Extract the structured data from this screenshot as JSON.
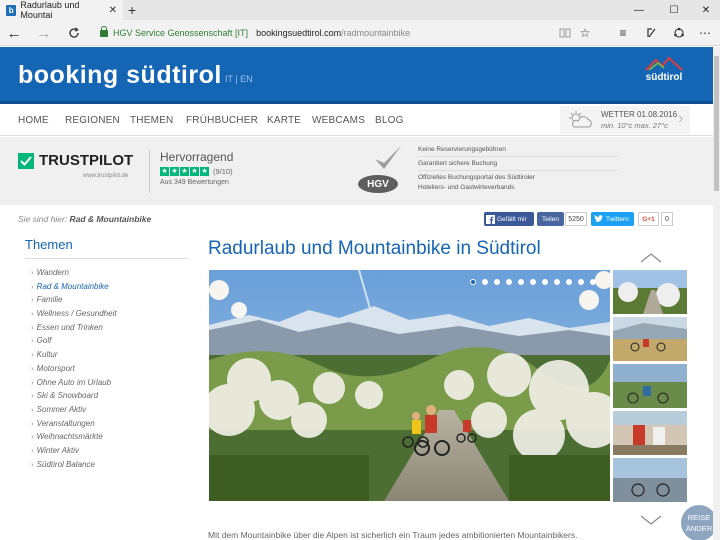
{
  "browser": {
    "tab_title": "Radurlaub und Mountai",
    "tab_favicon_letter": "b",
    "cert_owner": "HGV Service Genossenschaft [IT]",
    "url_host": "bookingsuedtirol.com",
    "url_path": "/radmountainbike"
  },
  "site": {
    "logo": "booking südtirol",
    "lang": "IT | EN",
    "brand_mark": "südtirol",
    "brand_color": "#1565b5"
  },
  "nav": {
    "items": [
      "HOME",
      "REGIONEN",
      "THEMEN",
      "FRÜHBUCHER",
      "KARTE",
      "WEBCAMS",
      "BLOG"
    ]
  },
  "weather": {
    "label": "WETTER 01.08.2016",
    "temps": "min. 10°c max. 27°c"
  },
  "trust": {
    "brand": "TRUSTPILOT",
    "url": "www.trustpilot.de",
    "rating": "Hervorragend",
    "score": "(9/10)",
    "reviews": "Aus 349 Bewertungen",
    "hgv": "HGV",
    "features": [
      "Keine Reservierungsgebühren",
      "Garantiert sichere Buchung",
      "Offizielles Buchungsportal des Südtiroler",
      "Hoteliers- und Gastwirteverbands"
    ]
  },
  "breadcrumb": {
    "prefix": "Sie sind hier:",
    "current": "Rad & Mountainbike"
  },
  "social": {
    "fb_like": "Gefällt mir",
    "fb_share": "Teilen",
    "share_count": "5250",
    "twitter": "Twittern",
    "gplus": "G+1",
    "gplus_count": "0"
  },
  "sidebar": {
    "title": "Themen",
    "active_index": 1,
    "items": [
      "Wandern",
      "Rad & Mountainbike",
      "Familie",
      "Wellness / Gesundheit",
      "Essen und Trinken",
      "Golf",
      "Kultur",
      "Motorsport",
      "Ohne Auto im Urlaub",
      "Ski & Snowboard",
      "Sommer Aktiv",
      "Veranstaltungen",
      "Weihnachtsmärkte",
      "Winter Aktiv",
      "Südtirol Balance"
    ]
  },
  "main": {
    "title": "Radurlaub und Mountainbike in Südtirol",
    "intro": "Mit dem Mountainbike über die Alpen ist sicherlich ein Traum jedes ambitionierten Mountainbikers.",
    "slides_total": 11,
    "slide_active": 1,
    "reise_button": "REISE ÄNDER"
  }
}
